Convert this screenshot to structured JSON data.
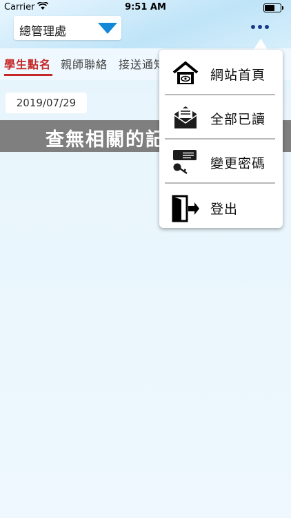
{
  "status_bar": {
    "carrier": "Carrier",
    "time": "9:51 AM"
  },
  "header": {
    "selector_label": "總管理處"
  },
  "tabs": [
    {
      "label": "學生點名"
    },
    {
      "label": "親師聯絡"
    },
    {
      "label": "接送通知"
    }
  ],
  "content": {
    "date": "2019/07/29",
    "empty_message": "查無相關的記錄"
  },
  "menu": {
    "items": [
      {
        "label": "網站首頁",
        "icon": "home-icon"
      },
      {
        "label": "全部已讀",
        "icon": "open-mail-icon"
      },
      {
        "label": "變更密碼",
        "icon": "key-icon"
      },
      {
        "label": "登出",
        "icon": "logout-icon"
      }
    ]
  },
  "colors": {
    "accent_red": "#c62828",
    "dropdown_blue": "#1289d8",
    "banner_gray": "#7f7f7f"
  }
}
